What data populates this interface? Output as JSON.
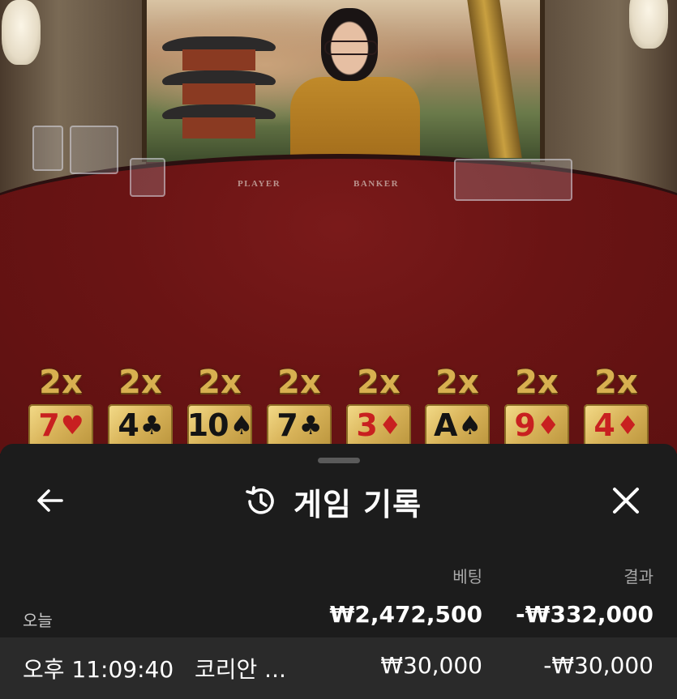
{
  "scene": {
    "table_labels": {
      "player": "PLAYER",
      "banker": "BANKER"
    }
  },
  "lucky_cards": [
    {
      "multiplier": "2x",
      "rank": "7",
      "suit": "♥",
      "color": "red"
    },
    {
      "multiplier": "2x",
      "rank": "4",
      "suit": "♣",
      "color": "black"
    },
    {
      "multiplier": "2x",
      "rank": "10",
      "suit": "♠",
      "color": "black"
    },
    {
      "multiplier": "2x",
      "rank": "7",
      "suit": "♣",
      "color": "black"
    },
    {
      "multiplier": "2x",
      "rank": "3",
      "suit": "♦",
      "color": "red"
    },
    {
      "multiplier": "2x",
      "rank": "A",
      "suit": "♠",
      "color": "black"
    },
    {
      "multiplier": "2x",
      "rank": "9",
      "suit": "♦",
      "color": "red"
    },
    {
      "multiplier": "2x",
      "rank": "4",
      "suit": "♦",
      "color": "red"
    }
  ],
  "sheet": {
    "title": "게임 기록",
    "icons": {
      "back": "arrow-left-icon",
      "history": "history-icon",
      "close": "close-icon"
    },
    "columns": {
      "bet": "베팅",
      "result": "결과"
    },
    "summary": {
      "label": "오늘",
      "bet": "₩2,472,500",
      "result": "-₩332,000"
    },
    "rows": [
      {
        "time": "오후 11:09:40",
        "game": "코리안 ...",
        "bet": "₩30,000",
        "result": "-₩30,000"
      }
    ]
  },
  "colors": {
    "sheet_bg": "#1c1c1c",
    "row_bg": "#2a2a2a",
    "card_gold": "#d9b45a",
    "multiplier_gold": "#d8b050",
    "table_red": "#6a1414"
  }
}
